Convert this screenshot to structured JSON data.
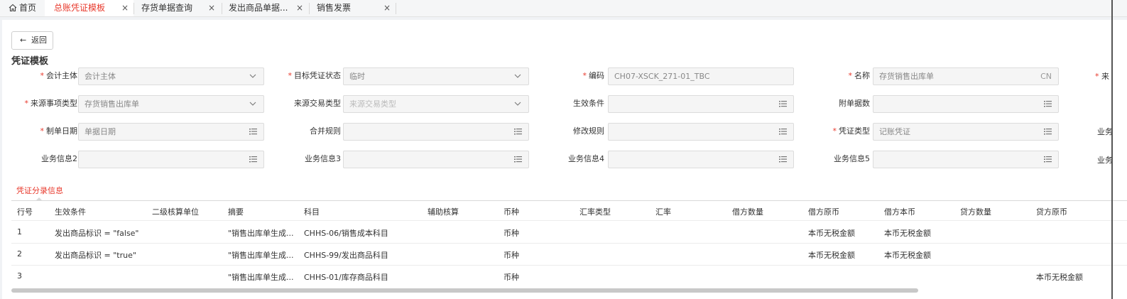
{
  "tabs": [
    {
      "label": "首页",
      "active": false
    },
    {
      "label": "总账凭证模板",
      "active": true
    },
    {
      "label": "存货单据查询",
      "active": false
    },
    {
      "label": "发出商品单据...",
      "active": false
    },
    {
      "label": "销售发票",
      "active": false
    }
  ],
  "close_glyph": "×",
  "back_button": {
    "arrow": "←",
    "label": "返回"
  },
  "page_title": "凭证模板",
  "icons": {
    "list": "list-icon",
    "dropdown": "chevron-down-icon",
    "home": "home-icon"
  },
  "form": {
    "rows": [
      [
        {
          "label": "会计主体",
          "required": true,
          "value": "会计主体",
          "type": "select",
          "placeholder": false
        },
        {
          "label": "目标凭证状态",
          "required": true,
          "value": "临时",
          "type": "select",
          "placeholder": false
        },
        {
          "label": "编码",
          "required": true,
          "value": "CH07-XSCK_271-01_TBC",
          "type": "text",
          "placeholder": false
        },
        {
          "label": "名称",
          "required": true,
          "value": "存货销售出库单",
          "suffix": "CN",
          "type": "text",
          "placeholder": false
        }
      ],
      [
        {
          "label": "来源事项类型",
          "required": true,
          "value": "存货销售出库单",
          "type": "select",
          "placeholder": false
        },
        {
          "label": "来源交易类型",
          "required": false,
          "value": "来源交易类型",
          "type": "select",
          "placeholder": true
        },
        {
          "label": "生效条件",
          "required": false,
          "value": "",
          "type": "list"
        },
        {
          "label": "附单据数",
          "required": false,
          "value": "",
          "type": "list"
        }
      ],
      [
        {
          "label": "制单日期",
          "required": true,
          "value": "单据日期",
          "type": "list",
          "placeholder": false
        },
        {
          "label": "合并规则",
          "required": false,
          "value": "",
          "type": "list"
        },
        {
          "label": "修改规则",
          "required": false,
          "value": "",
          "type": "list"
        },
        {
          "label": "凭证类型",
          "required": true,
          "value": "记账凭证",
          "type": "list",
          "placeholder": false
        }
      ],
      [
        {
          "label": "业务信息2",
          "required": false,
          "value": "",
          "type": "list"
        },
        {
          "label": "业务信息3",
          "required": false,
          "value": "",
          "type": "list"
        },
        {
          "label": "业务信息4",
          "required": false,
          "value": "",
          "type": "list"
        },
        {
          "label": "业务信息5",
          "required": false,
          "value": "",
          "type": "list"
        }
      ]
    ],
    "clipped_labels": [
      "来",
      "业务",
      "业务"
    ]
  },
  "entries": {
    "section_label": "凭证分录信息",
    "columns": [
      "行号",
      "生效条件",
      "二级核算单位",
      "摘要",
      "科目",
      "辅助核算",
      "币种",
      "汇率类型",
      "汇率",
      "借方数量",
      "借方原币",
      "借方本币",
      "贷方数量",
      "贷方原币"
    ],
    "rows": [
      [
        "1",
        "发出商品标识 = \"false\"",
        "",
        "\"销售出库单生成...",
        "CHHS-06/销售成本科目",
        "",
        "币种",
        "",
        "",
        "",
        "本币无税金额",
        "本币无税金额",
        "",
        ""
      ],
      [
        "2",
        "发出商品标识 = \"true\"",
        "",
        "\"销售出库单生成...",
        "CHHS-99/发出商品科目",
        "",
        "币种",
        "",
        "",
        "",
        "本币无税金额",
        "本币无税金额",
        "",
        ""
      ],
      [
        "3",
        "",
        "",
        "\"销售出库单生成...",
        "CHHS-01/库存商品科目",
        "",
        "币种",
        "",
        "",
        "",
        "",
        "",
        "",
        "本币无税金额"
      ]
    ]
  }
}
